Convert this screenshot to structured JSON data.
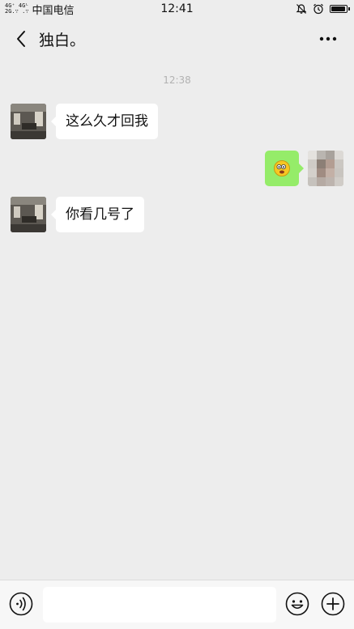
{
  "status_bar": {
    "signal_top": "4G⁺ 4Gᴸ",
    "signal_bottom": "2G.∵ .∵",
    "carrier": "中国电信",
    "time": "12:41",
    "icons": [
      "mute-bell-icon",
      "alarm-clock-icon",
      "battery-icon"
    ],
    "battery_level": 0.95
  },
  "header": {
    "title": "独白。",
    "back_icon": "chevron-left-icon",
    "more_icon": "more-dots-icon"
  },
  "chat": {
    "timestamp": "12:38",
    "messages": [
      {
        "side": "incoming",
        "text": "这么久才回我"
      },
      {
        "side": "outgoing",
        "text": "",
        "content": "emoji-sticker"
      },
      {
        "side": "incoming",
        "text": "你看几号了"
      }
    ]
  },
  "input_bar": {
    "voice_icon": "voice-icon",
    "emoji_icon": "emoji-icon",
    "plus_icon": "plus-icon",
    "placeholder": ""
  },
  "colors": {
    "background": "#ededed",
    "incoming_bubble": "#ffffff",
    "outgoing_bubble": "#95ec69",
    "timestamp": "#b2b2b2"
  }
}
